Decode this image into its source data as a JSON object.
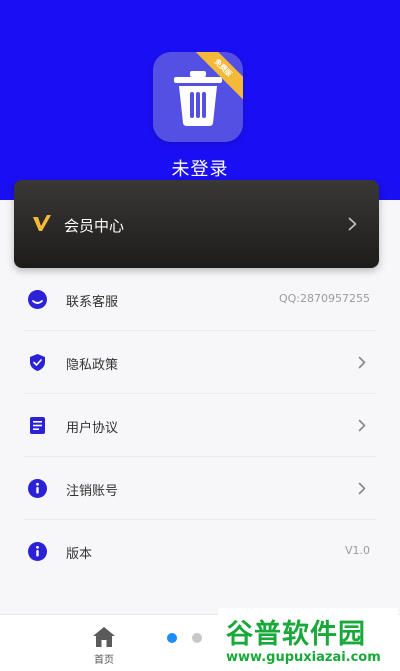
{
  "header": {
    "app_badge": "免费版",
    "login_status": "未登录"
  },
  "vip": {
    "label": "会员中心"
  },
  "menu": [
    {
      "label": "联系客服",
      "value": "QQ:2870957255",
      "icon": "headset-icon",
      "has_arrow": false
    },
    {
      "label": "隐私政策",
      "value": "",
      "icon": "shield-icon",
      "has_arrow": true
    },
    {
      "label": "用户协议",
      "value": "",
      "icon": "document-icon",
      "has_arrow": true
    },
    {
      "label": "注销账号",
      "value": "",
      "icon": "info-icon",
      "has_arrow": true
    },
    {
      "label": "版本",
      "value": "V1.0",
      "icon": "info-icon",
      "has_arrow": false
    }
  ],
  "tabbar": {
    "home_label": "首页"
  },
  "watermark": {
    "title": "谷普软件园",
    "url": "www.gupuxiazai.com"
  },
  "colors": {
    "header_bg": "#1a0ff2",
    "accent": "#2b21d6",
    "vip_gold": "#f5b93a",
    "dot_active": "#1d8cf8",
    "dot_inactive": "#c8c8c8",
    "watermark_green": "#19a83a"
  }
}
